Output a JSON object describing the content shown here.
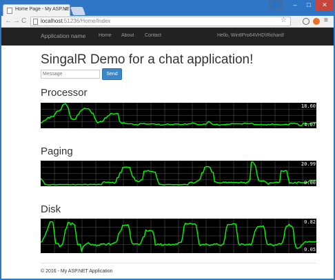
{
  "browser": {
    "tab_title": "Home Page - My ASP.NET",
    "tab_close": "×",
    "url_host": "localhost",
    "url_path": ":51236/Home/Index",
    "back_glyph": "←",
    "forward_glyph": "→",
    "reload_glyph": "C",
    "star_glyph": "☆",
    "menu_glyph": "≡",
    "min_glyph": "–",
    "max_glyph": "□",
    "close_glyph": "✕",
    "user_glyph": "👤"
  },
  "navbar": {
    "brand": "Application name",
    "links": [
      "Home",
      "About",
      "Contact"
    ],
    "hello": "Hello, Win8Pro64VHD\\Richard!"
  },
  "main": {
    "title": "SingalR Demo for a chat application!",
    "message_placeholder": "Message",
    "send_label": "Send"
  },
  "charts": [
    {
      "heading": "Processor",
      "max_label": "18.60",
      "min_label": "4.07",
      "line_color": "#00ff00",
      "grid_color": "#555555"
    },
    {
      "heading": "Paging",
      "max_label": "20.99",
      "min_label": "0.00",
      "line_color": "#00ff00",
      "grid_color": "#555555"
    },
    {
      "heading": "Disk",
      "max_label": "0.82",
      "min_label": "0.05",
      "line_color": "#00ff00",
      "grid_color": "#555555"
    }
  ],
  "chart_data": [
    {
      "type": "line",
      "title": "Processor",
      "ylim": [
        4.07,
        18.6
      ],
      "grid": true,
      "series": [
        {
          "values": [
            6.6,
            6.9,
            8.0,
            8.2,
            8.9,
            10.1,
            9.7,
            10.7,
            10.6,
            10.9,
            12.5,
            14.0,
            14.2,
            14.4,
            15.2,
            17.9,
            18.5,
            19.0,
            17.6,
            15.9,
            11.7,
            9.3,
            9.0,
            8.8,
            9.0,
            11.4,
            12.0,
            13.9,
            14.7,
            15.3,
            16.0,
            15.7,
            15.6,
            15.6,
            14.4,
            12.8,
            12.8,
            9.9,
            8.2,
            6.6,
            7.2,
            7.6,
            7.4,
            8.0,
            9.8,
            9.8,
            11.1,
            11.4,
            12.6,
            12.6,
            12.1,
            12.5,
            12.6,
            12.7,
            8.0,
            6.8,
            6.4,
            6.8,
            6.3,
            6.2,
            6.0,
            6.1,
            6.1,
            5.9,
            5.4,
            5.6,
            5.3,
            5.3,
            6.2,
            6.2,
            6.1,
            6.3,
            5.8,
            5.9,
            5.8,
            5.9,
            6.1,
            6.0,
            5.9,
            5.7,
            5.6,
            5.9,
            5.2,
            5.3,
            5.3,
            5.5,
            5.7,
            6.0,
            5.7,
            5.5,
            5.6,
            5.5,
            6.0,
            5.8,
            6.0,
            5.6,
            5.5,
            5.6,
            5.7,
            6.1,
            5.6,
            5.9,
            6.1,
            6.0,
            6.7,
            6.5,
            6.2,
            5.7,
            5.5,
            5.5,
            5.4,
            5.6,
            6.0,
            5.6,
            6.5,
            7.5,
            7.2,
            6.2,
            5.7,
            5.6,
            5.6,
            5.8,
            5.2,
            5.2,
            5.5,
            5.5,
            5.6,
            5.5,
            5.9,
            5.6,
            5.9,
            6.2,
            6.0,
            6.1,
            6.0,
            6.1,
            6.0,
            6.1,
            5.8,
            6.2,
            6.5,
            6.2,
            6.2,
            6.1,
            6.3,
            6.3,
            5.7,
            5.6,
            5.6,
            5.5,
            5.5,
            5.7,
            5.5,
            5.4,
            5.5,
            5.2,
            5.7,
            5.4,
            5.7,
            6.0,
            5.5,
            5.6,
            5.6,
            5.6,
            5.3,
            5.4,
            5.5,
            5.6,
            5.7,
            5.6,
            5.3,
            6.3,
            6.4,
            6.2,
            6.5,
            6.0,
            6.2,
            5.1,
            4.9,
            5.0,
            6.4,
            6.3,
            6.2,
            5.9,
            5.9,
            6.5,
            6.6,
            6.8,
            6.8,
            6.7
          ]
        }
      ]
    },
    {
      "type": "line",
      "title": "Paging",
      "ylim": [
        0.0,
        20.99
      ],
      "grid": true,
      "series": [
        {
          "values": [
            6.1,
            4.5,
            2.9,
            0.3,
            0.3,
            0.0,
            0.0,
            0.0,
            0.3,
            0.4,
            0.1,
            0.0,
            0.2,
            0.3,
            0.3,
            0.1,
            0.4,
            0.2,
            0.3,
            0.3,
            0.2,
            0.1,
            0.2,
            0.5,
            0.0,
            0.1,
            0.3,
            0.3,
            0.3,
            0.1,
            0.2,
            0.5,
            0.5,
            0.0,
            0.1,
            0.5,
            0.3,
            0.4,
            0.5,
            0.1,
            0.3,
            0.5,
            0.3,
            0.2,
            2.4,
            2.8,
            2.2,
            2.4,
            2.5,
            2.1,
            2.3,
            2.4,
            1.4,
            2.1,
            6.5,
            6.8,
            11.0,
            11.6,
            15.7,
            16.3,
            16.4,
            16.4,
            16.1,
            16.1,
            11.6,
            7.5,
            6.8,
            3.8,
            3.8,
            2.8,
            3.2,
            4.6,
            4.6,
            12.5,
            12.8,
            12.6,
            13.3,
            12.6,
            12.4,
            12.4,
            11.7,
            11.8,
            7.4,
            3.0,
            0.4,
            0.5,
            0.0,
            0.1,
            0.0,
            0.4,
            0.4,
            0.3,
            0.4,
            0.1,
            0.2,
            0.1,
            0.4,
            0.0,
            0.0,
            0.2,
            0.1,
            0.3,
            0.5,
            0.2,
            0.0,
            1.9,
            2.5,
            2.3,
            1.6,
            1.9,
            2.8,
            3.7,
            4.2,
            5.7,
            11.2,
            11.3,
            16.0,
            16.8,
            16.8,
            16.6,
            15.7,
            11.7,
            11.5,
            2.8,
            2.7,
            1.9,
            1.9,
            1.8,
            1.7,
            2.6,
            2.3,
            2.6,
            1.8,
            2.4,
            2.2,
            2.5,
            1.9,
            2.2,
            2.2,
            2.2,
            1.7,
            2.3,
            2.6,
            1.9,
            2.2,
            1.4,
            2.5,
            2.6,
            5.0,
            20.9,
            21.0,
            19.4,
            17.1,
            10.1,
            4.3,
            3.7,
            3.4,
            3.7,
            3.7,
            2.7,
            1.8,
            0.5,
            1.9,
            1.9,
            1.7,
            1.9,
            2.3,
            2.5,
            2.1,
            2.7,
            12.9,
            12.8,
            12.4,
            13.2,
            12.9,
            6.4,
            1.4,
            2.1,
            1.4,
            1.6,
            2.5,
            1.3,
            2.7,
            2.6,
            1.9,
            1.9,
            2.0,
            1.8,
            2.2,
            2.2,
            3.7,
            4.3,
            4.1,
            4.1,
            4.3,
            4.0
          ]
        }
      ]
    },
    {
      "type": "line",
      "title": "Disk",
      "ylim": [
        0.05,
        0.82
      ],
      "grid": true,
      "series": [
        {
          "values": [
            0.28,
            0.3,
            0.38,
            0.42,
            0.52,
            0.59,
            0.7,
            0.78,
            0.78,
            0.77,
            0.5,
            0.25,
            0.25,
            0.25,
            0.17,
            0.2,
            0.23,
            0.37,
            0.57,
            0.63,
            0.76,
            0.76,
            0.7,
            0.75,
            0.72,
            0.7,
            0.44,
            0.22,
            0.23,
            0.23,
            0.06,
            0.17,
            0.2,
            0.23,
            0.25,
            0.27,
            0.24,
            0.21,
            0.23,
            0.21,
            0.22,
            0.19,
            0.21,
            0.2,
            0.24,
            0.23,
            0.25,
            0.23,
            0.21,
            0.24,
            0.26,
            0.21,
            0.24,
            0.25,
            0.27,
            0.28,
            0.32,
            0.48,
            0.53,
            0.57,
            0.69,
            0.68,
            0.7,
            0.69,
            0.71,
            0.61,
            0.36,
            0.26,
            0.23,
            0.24,
            0.24,
            0.24,
            0.22,
            0.24,
            0.31,
            0.4,
            0.42,
            0.58,
            0.55,
            0.55,
            0.57,
            0.56,
            0.55,
            0.45,
            0.21,
            0.22,
            0.24,
            0.22,
            0.25,
            0.2,
            0.21,
            0.23,
            0.22,
            0.21,
            0.24,
            0.21,
            0.22,
            0.23,
            0.22,
            0.24,
            0.23,
            0.27,
            0.28,
            0.28,
            0.4,
            0.66,
            0.74,
            0.73,
            0.72,
            0.74,
            0.74,
            0.72,
            0.72,
            0.73,
            0.69,
            0.48,
            0.24,
            0.2,
            0.22,
            0.23,
            0.22,
            0.24,
            0.23,
            0.21,
            0.2,
            0.22,
            0.21,
            0.24,
            0.23,
            0.25,
            0.22,
            0.21,
            0.2,
            0.22,
            0.24,
            0.39,
            0.62,
            0.71,
            0.71,
            0.71,
            0.71,
            0.73,
            0.73,
            0.72,
            0.48,
            0.24,
            0.21,
            0.24,
            0.24,
            0.22,
            0.21,
            0.23,
            0.22,
            0.24,
            0.21,
            0.28,
            0.43,
            0.55,
            0.61,
            0.66,
            0.66,
            0.67,
            0.66,
            0.68,
            0.6,
            0.36,
            0.23,
            0.22,
            0.24,
            0.23,
            0.2,
            0.2,
            0.22,
            0.21,
            0.24,
            0.25,
            0.23,
            0.27,
            0.36,
            0.58,
            0.67,
            0.67,
            0.72,
            0.67,
            0.67,
            0.61,
            0.29,
            0.16,
            0.13,
            0.14,
            0.15,
            0.21,
            0.23,
            0.27,
            0.3,
            0.28,
            0.29,
            0.3,
            0.29,
            0.29,
            0.29,
            0.29,
            0.3
          ]
        }
      ]
    }
  ],
  "footer": {
    "text": "© 2016 - My ASP.NET Application"
  }
}
